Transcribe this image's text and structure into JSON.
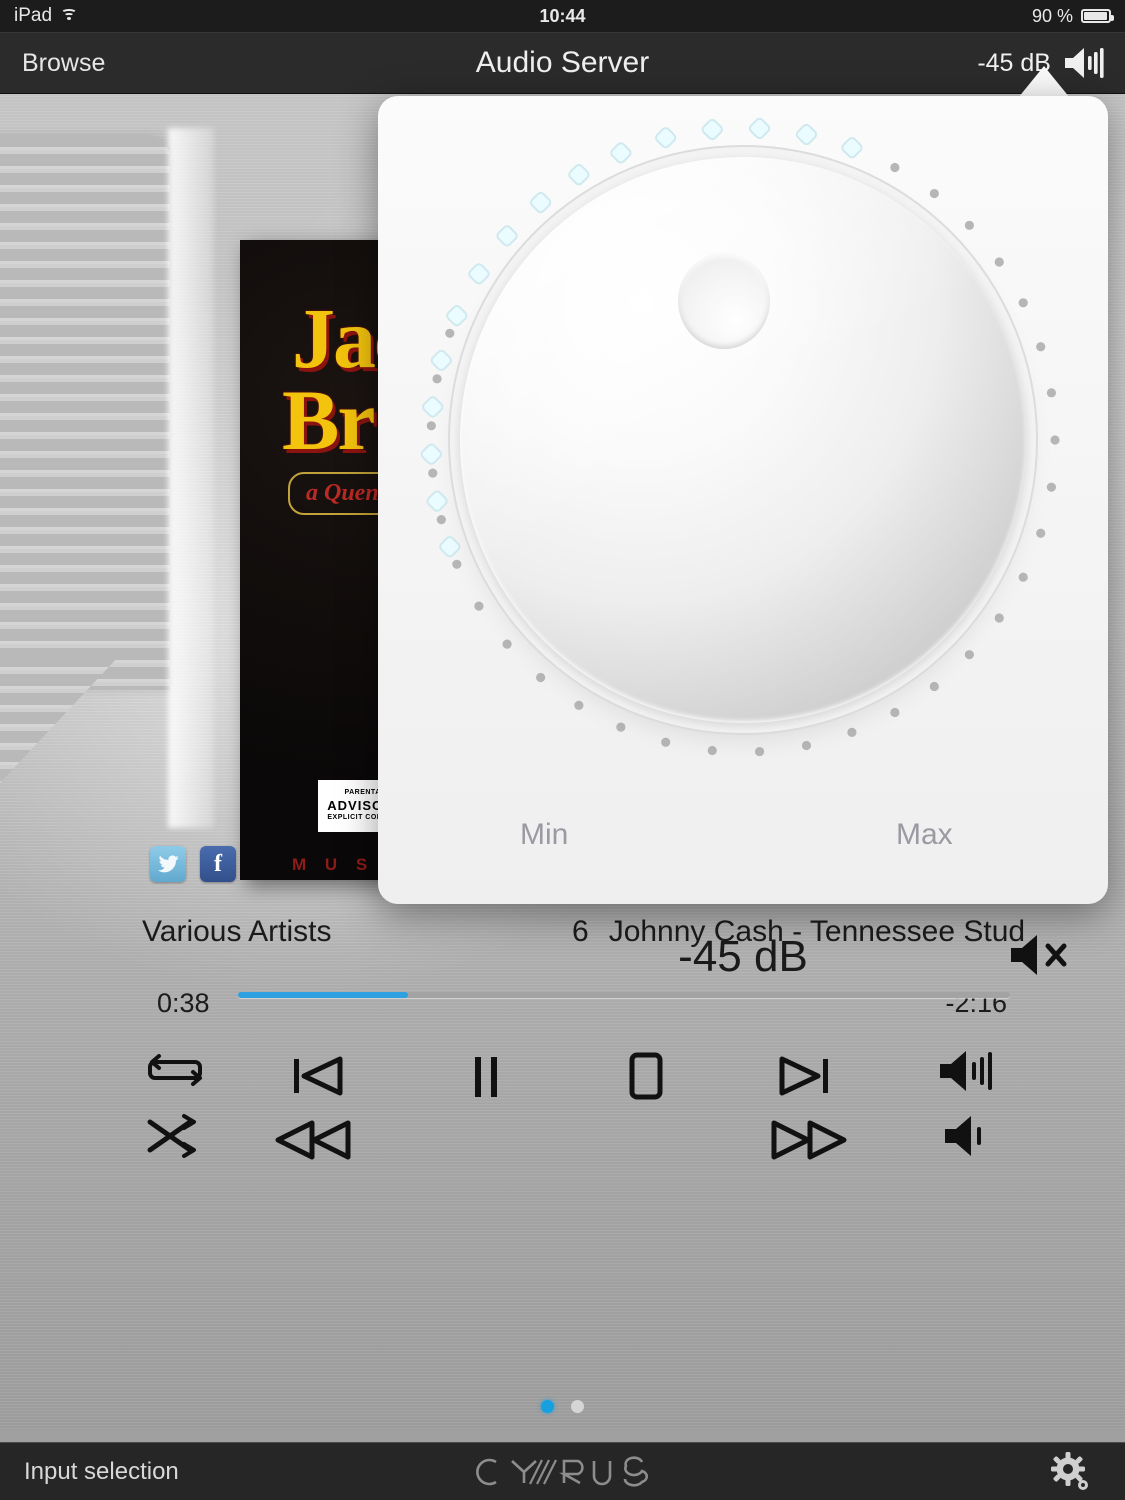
{
  "status_bar": {
    "device": "iPad",
    "wifi_icon": "wifi-icon",
    "time": "10:44",
    "battery_percent": "90 %",
    "battery_level": 90
  },
  "nav_bar": {
    "back_label": "Browse",
    "title": "Audio Server",
    "volume_readout": "-45 dB",
    "volume_icon": "speaker-waves-icon"
  },
  "album": {
    "title_line1": "Jac",
    "title_line2": "Br",
    "tagline": "a Quentin",
    "advisory_top": "PARENTAL",
    "advisory_mid": "ADVISORY",
    "advisory_bottom": "EXPLICIT CONTENT",
    "music_text": "M U S I C   F"
  },
  "social": {
    "twitter_label": "twitter-icon",
    "facebook_label": "f"
  },
  "now_playing": {
    "artist": "Various Artists",
    "track_number": "6",
    "track_title": "Johnny Cash - Tennessee Stud",
    "elapsed": "0:38",
    "remaining": "-2:16",
    "progress_percent": 22
  },
  "transport": {
    "buttons": [
      {
        "name": "repeat-button",
        "label": "repeat-icon"
      },
      {
        "name": "previous-button",
        "label": "previous-track-icon"
      },
      {
        "name": "pause-button",
        "label": "pause-icon"
      },
      {
        "name": "stop-button",
        "label": "stop-icon"
      },
      {
        "name": "next-button",
        "label": "next-track-icon"
      },
      {
        "name": "volume-up-button",
        "label": "volume-up-icon"
      },
      {
        "name": "shuffle-button",
        "label": "shuffle-icon"
      },
      {
        "name": "rewind-button",
        "label": "rewind-icon"
      },
      {
        "name": "fast-forward-button",
        "label": "fast-forward-icon"
      },
      {
        "name": "volume-down-button",
        "label": "volume-down-icon"
      }
    ]
  },
  "pagination": {
    "total": 2,
    "active_index": 0
  },
  "bottom_bar": {
    "input_selection_label": "Input selection",
    "brand_logo": "CYRUS",
    "settings_icon": "gear-icon"
  },
  "volume_popover": {
    "min_label": "Min",
    "max_label": "Max",
    "value_label": "-45 dB",
    "mute_icon": "speaker-mute-icon",
    "led_total": 47,
    "led_lit": 16
  },
  "colors": {
    "accent_blue": "#2fa0e0",
    "page_dot_active": "#16a0e0",
    "twitter_blue": "#61a9cf",
    "facebook_blue": "#31508b",
    "navbar_bg": "#2b2b2b",
    "statusbar_bg": "#1c1c1c",
    "bottombar_bg": "#262626",
    "led_lit_color": "#eafcff"
  }
}
